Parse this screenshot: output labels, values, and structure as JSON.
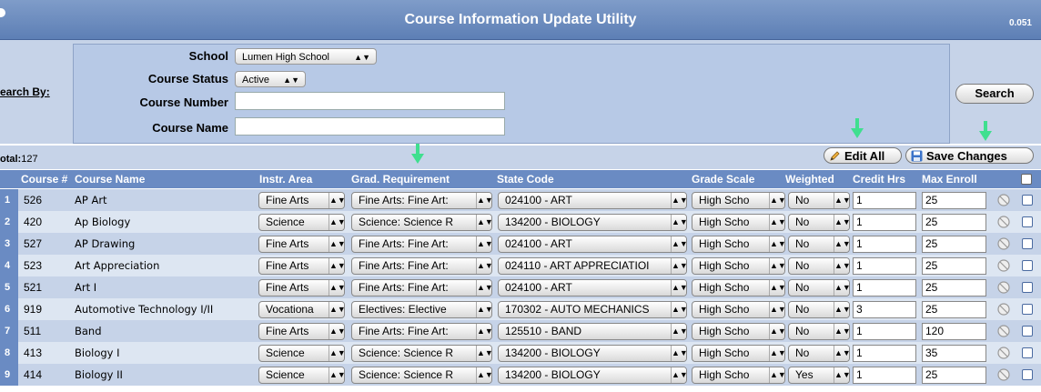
{
  "title": "Course Information Update Utility",
  "version": "0.051",
  "search": {
    "search_by_label": "earch By:",
    "school_label": "School",
    "school_value": "Lumen High School",
    "status_label": "Course Status",
    "status_value": "Active",
    "number_label": "Course Number",
    "number_value": "",
    "name_label": "Course Name",
    "name_value": "",
    "search_button": "Search"
  },
  "toolbar": {
    "total_label": "otal:",
    "total_value": "127",
    "edit_all": "Edit All",
    "save_changes": "Save Changes"
  },
  "columns": {
    "course_num": "Course #",
    "course_name": "Course Name",
    "instr_area": "Instr. Area",
    "grad_req": "Grad. Requirement",
    "state_code": "State Code",
    "grade_scale": "Grade Scale",
    "weighted": "Weighted",
    "credit_hrs": "Credit Hrs",
    "max_enroll": "Max Enroll"
  },
  "rows": [
    {
      "n": "1",
      "num": "526",
      "name": "AP Art",
      "area": "Fine Arts",
      "grad": "Fine Arts: Fine Art:",
      "state": "024100 - ART",
      "scale": "High Scho",
      "weighted": "No",
      "credit": "1",
      "max": "25"
    },
    {
      "n": "2",
      "num": "420",
      "name": "Ap Biology",
      "area": "Science",
      "grad": "Science: Science R",
      "state": "134200 - BIOLOGY",
      "scale": "High Scho",
      "weighted": "No",
      "credit": "1",
      "max": "25"
    },
    {
      "n": "3",
      "num": "527",
      "name": "AP Drawing",
      "area": "Fine Arts",
      "grad": "Fine Arts: Fine Art:",
      "state": "024100 - ART",
      "scale": "High Scho",
      "weighted": "No",
      "credit": "1",
      "max": "25"
    },
    {
      "n": "4",
      "num": "523",
      "name": "Art Appreciation",
      "area": "Fine Arts",
      "grad": "Fine Arts: Fine Art:",
      "state": "024110 - ART APPRECIATIOI",
      "scale": "High Scho",
      "weighted": "No",
      "credit": "1",
      "max": "25"
    },
    {
      "n": "5",
      "num": "521",
      "name": "Art I",
      "area": "Fine Arts",
      "grad": "Fine Arts: Fine Art:",
      "state": "024100 - ART",
      "scale": "High Scho",
      "weighted": "No",
      "credit": "1",
      "max": "25"
    },
    {
      "n": "6",
      "num": "919",
      "name": "Automotive Technology I/II",
      "area": "Vocationa",
      "grad": "Electives: Elective",
      "state": "170302 - AUTO MECHANICS",
      "scale": "High Scho",
      "weighted": "No",
      "credit": "3",
      "max": "25"
    },
    {
      "n": "7",
      "num": "511",
      "name": "Band",
      "area": "Fine Arts",
      "grad": "Fine Arts: Fine Art:",
      "state": "125510 - BAND",
      "scale": "High Scho",
      "weighted": "No",
      "credit": "1",
      "max": "120"
    },
    {
      "n": "8",
      "num": "413",
      "name": "Biology I",
      "area": "Science",
      "grad": "Science: Science R",
      "state": "134200 - BIOLOGY",
      "scale": "High Scho",
      "weighted": "No",
      "credit": "1",
      "max": "35"
    },
    {
      "n": "9",
      "num": "414",
      "name": "Biology II",
      "area": "Science",
      "grad": "Science: Science R",
      "state": "134200 - BIOLOGY",
      "scale": "High Scho",
      "weighted": "Yes",
      "credit": "1",
      "max": "25"
    }
  ],
  "colors": {
    "title_bar": "#5d7fb5",
    "header": "#6a8bc3",
    "row_odd": "#c6d3e8",
    "row_even": "#dde6f2",
    "annotation_arrow": "#3fdf8f"
  },
  "icons": {
    "edit_all": "pencil-icon",
    "save_changes": "floppy-disk-icon",
    "row_action": "no-entry-icon",
    "annotation": "green-arrow-icon"
  }
}
